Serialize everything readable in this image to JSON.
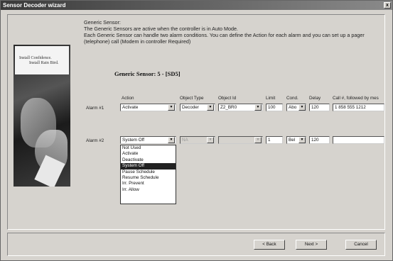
{
  "window": {
    "title": "Sensor Decoder wizard",
    "close_label": "x"
  },
  "intro": {
    "heading": "Generic Sensor:",
    "line1": "The Generic Sensors are active when the controller is in Auto Mode.",
    "line2": "Each Generic Sensor can handle two alarm conditions. You can define the Action for each alarm and you can set up a pager (telephone) call (Modem in controller Required)"
  },
  "sidebar": {
    "logo_line1": "Install Confidence.",
    "logo_line2": "Install Rain Bird."
  },
  "section_title": "Generic Sensor: 5 - [SD5]",
  "columns": {
    "action": "Action",
    "object_type": "Object Type",
    "object_id": "Object Id",
    "limit": "Limit",
    "cond": "Cond.",
    "delay": "Delay",
    "call": "Call #, followed by mes"
  },
  "alarm1": {
    "label": "Alarm #1",
    "action": "Activate",
    "object_type": "Decoder",
    "object_id": "Z2_BR0",
    "limit": "100",
    "cond": "Abo",
    "delay": "120",
    "call": "1 858 555 1212"
  },
  "alarm2": {
    "label": "Alarm #2",
    "action": "System Off",
    "object_type": "NA",
    "object_id": "",
    "limit": "1",
    "cond": "Bel",
    "delay": "120",
    "call": ""
  },
  "dropdown_options": [
    "Not Used",
    "Activate",
    "Deactivate",
    "System Off",
    "Pause Schedule",
    "Resume Schedule",
    "Irr. Prevent",
    "Irr. Allow"
  ],
  "dropdown_selected_index": 3,
  "buttons": {
    "back": "< Back",
    "next": "Next >",
    "cancel": "Cancel"
  }
}
